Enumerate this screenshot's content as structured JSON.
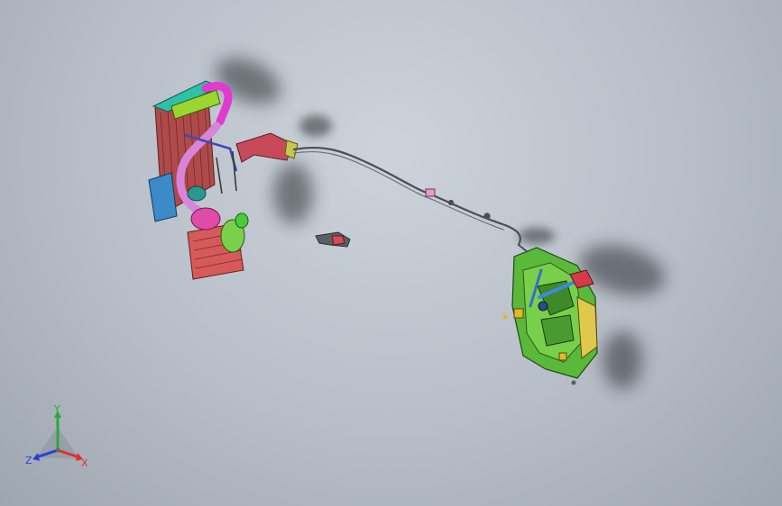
{
  "triad": {
    "x_label": "X",
    "y_label": "Y",
    "z_label": "Z",
    "x_color": "#e0302a",
    "y_color": "#2ea83a",
    "z_color": "#2a3ed6"
  },
  "scene": {
    "background_top": "#cdd3da",
    "background_bottom": "#9ea6b0"
  }
}
